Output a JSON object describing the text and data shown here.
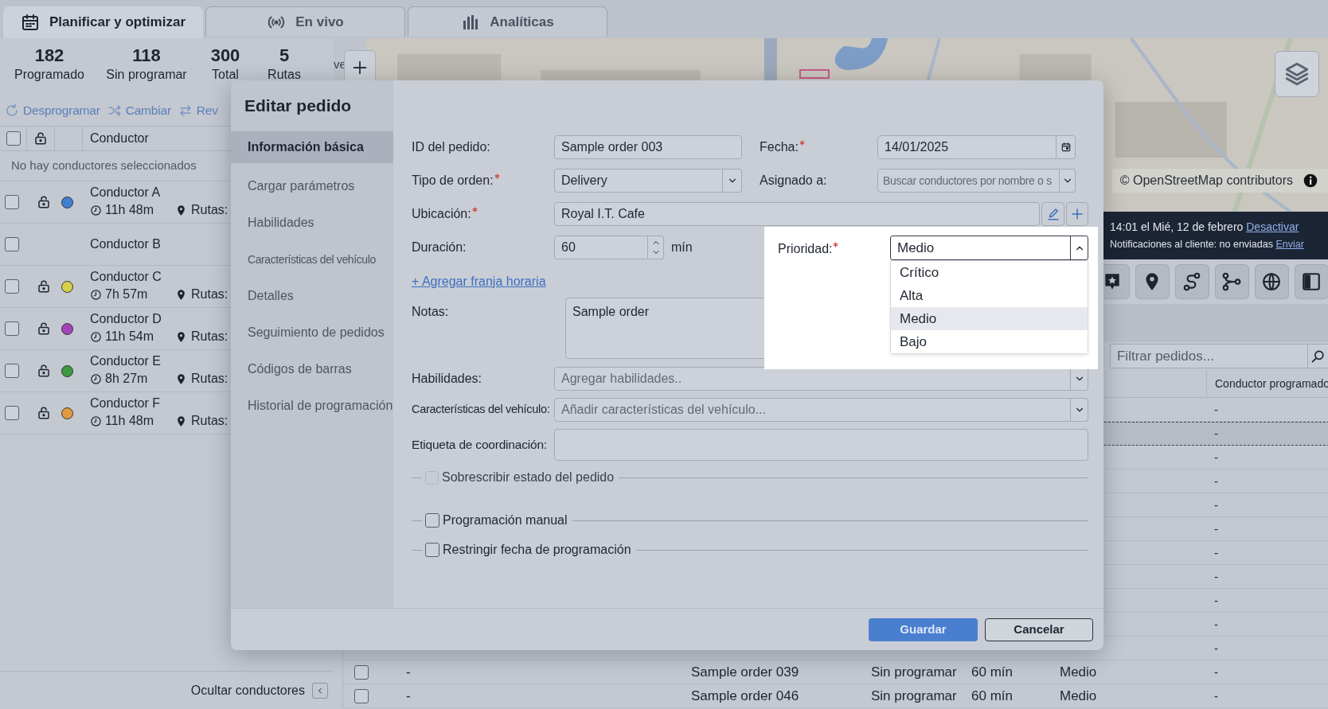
{
  "tabs": [
    {
      "label": "Planificar y optimizar",
      "selected": true
    },
    {
      "label": "En vivo",
      "selected": false
    },
    {
      "label": "Analíticas",
      "selected": false
    }
  ],
  "stats": [
    {
      "value": "182",
      "label": "Programado"
    },
    {
      "value": "118",
      "label": "Sin programar"
    },
    {
      "value": "300",
      "label": "Total"
    },
    {
      "value": "5",
      "label": "Rutas"
    }
  ],
  "actions": [
    "Desprogramar",
    "Cambiar",
    "Rev"
  ],
  "drivers": {
    "header_checked": false,
    "header": "Conductor",
    "empty_message": "No hay conductores seleccionados",
    "rows": [
      {
        "kind": "assigned",
        "name": "Conductor A",
        "color": "#3f7fd0",
        "time": "11h 48m",
        "routes": "Rutas:",
        "checked": false
      },
      {
        "kind": "plain",
        "name": "Conductor B",
        "checked": false
      },
      {
        "kind": "assigned",
        "name": "Conductor C",
        "color": "#d6cf4a",
        "time": "7h 57m",
        "routes": "Rutas:",
        "checked": false
      },
      {
        "kind": "assigned",
        "name": "Conductor D",
        "color": "#a345b8",
        "time": "11h 54m",
        "routes": "Rutas:",
        "checked": false
      },
      {
        "kind": "assigned",
        "name": "Conductor E",
        "color": "#3f9a3f",
        "time": "8h 27m",
        "routes": "Rutas:",
        "checked": false
      },
      {
        "kind": "assigned",
        "name": "Conductor F",
        "color": "#e39a3c",
        "time": "11h 48m",
        "routes": "Rutas:",
        "checked": false
      }
    ],
    "hide_label": "Ocultar conductores"
  },
  "map": {
    "cut_text": "ve",
    "attribution": "© OpenStreetMap contributors"
  },
  "notification": {
    "time_text": "14:01 el Mié, 12 de febrero",
    "time_link": "Desactivar",
    "customer_text": "Notificaciones al cliente: no enviadas",
    "customer_link": "Enviar"
  },
  "orders": {
    "filter_placeholder": "Filtrar pedidos...",
    "header": "Conductor programado",
    "rows": [
      {
        "scheduled_driver": "-",
        "selected": false
      },
      {
        "scheduled_driver": "-",
        "selected": true
      },
      {
        "scheduled_driver": "-",
        "selected": false
      },
      {
        "scheduled_driver": "-",
        "selected": false
      },
      {
        "scheduled_driver": "-",
        "selected": false
      },
      {
        "scheduled_driver": "-",
        "selected": false
      },
      {
        "scheduled_driver": "-",
        "selected": false
      },
      {
        "scheduled_driver": "-",
        "selected": false
      },
      {
        "scheduled_driver": "-",
        "selected": false
      },
      {
        "scheduled_driver": "-",
        "selected": false
      },
      {
        "scheduled_driver": "-",
        "selected": false
      },
      {
        "checked": false,
        "column_2": "-",
        "order": "Sample order 039",
        "status": "Sin programar",
        "duration": "60 mín",
        "priority": "Medio",
        "scheduled_driver": "-",
        "selected": false
      },
      {
        "checked": false,
        "column_2": "-",
        "order": "Sample order 046",
        "status": "Sin programar",
        "duration": "60 mín",
        "priority": "Medio",
        "scheduled_driver": "-",
        "selected": false
      }
    ]
  },
  "dialog": {
    "title": "Editar pedido",
    "sections": [
      {
        "label": "Información básica",
        "selected": true
      },
      {
        "label": "Cargar parámetros",
        "selected": false
      },
      {
        "label": "Habilidades",
        "selected": false
      },
      {
        "label": "Características del vehículo",
        "selected": false
      },
      {
        "label": "Detalles",
        "selected": false
      },
      {
        "label": "Seguimiento de pedidos",
        "selected": false
      },
      {
        "label": "Códigos de barras",
        "selected": false
      },
      {
        "label": "Historial de programación",
        "selected": false
      }
    ],
    "order_id": {
      "label": "ID del pedido:",
      "value": "Sample order 003"
    },
    "date": {
      "label": "Fecha:",
      "required": true,
      "value": "14/01/2025"
    },
    "order_type": {
      "label": "Tipo de orden:",
      "required": true,
      "value": "Delivery"
    },
    "assigned": {
      "label": "Asignado a:",
      "placeholder": "Buscar conductores por nombre o s"
    },
    "location": {
      "label": "Ubicación:",
      "required": true,
      "value": "Royal I.T. Cafe"
    },
    "duration": {
      "label": "Duración:",
      "value": "60",
      "unit": "mín"
    },
    "priority": {
      "label": "Prioridad:",
      "required": true,
      "value": "Medio",
      "expanded": true,
      "options": [
        {
          "label": "Crítico",
          "selected": false
        },
        {
          "label": "Alta",
          "selected": false
        },
        {
          "label": "Medio",
          "selected": true
        },
        {
          "label": "Bajo",
          "selected": false
        }
      ]
    },
    "add_time_window": "+ Agregar franja horaria",
    "notes": {
      "label": "Notas:",
      "value": "Sample order"
    },
    "skills": {
      "label": "Habilidades:",
      "placeholder": "Agregar habilidades.."
    },
    "vehicle": {
      "label": "Características del vehículo:",
      "placeholder": "Añadir características del vehículo..."
    },
    "coordination": {
      "label": "Etiqueta de coordinación:"
    },
    "checkboxes": [
      {
        "label": "Sobrescribir estado del pedido",
        "checked": false,
        "disabled": true
      },
      {
        "label": "Programación manual",
        "checked": false,
        "disabled": false
      },
      {
        "label": "Restringir fecha de programación",
        "checked": false,
        "disabled": false
      }
    ],
    "buttons": [
      {
        "label": "Guardar",
        "kind": "primary"
      },
      {
        "label": "Cancelar",
        "kind": "secondary"
      }
    ]
  }
}
